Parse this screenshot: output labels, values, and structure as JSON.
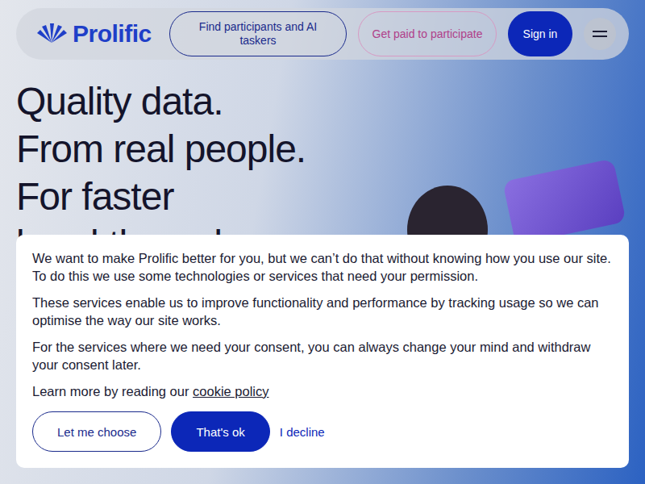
{
  "nav": {
    "logo": "Prolific",
    "buttons": [
      {
        "label": "Find participants and AI taskers",
        "kind": "outline"
      },
      {
        "label": "Get paid to participate",
        "kind": "pink"
      },
      {
        "label": "Sign in",
        "kind": "filled"
      }
    ]
  },
  "hero": {
    "lines": [
      "Quality data.",
      "From real people.",
      "For faster",
      "breakthroughs"
    ]
  },
  "cookie_banner": {
    "paragraphs": [
      "We want to make Prolific better for you, but we can’t do that without knowing how you use our site. To do this we use some technologies or services that need your permission.",
      "These services enable us to improve functionality and performance by tracking usage so we can optimise the way our site works.",
      "For the services where we need your consent, you can always change your mind and withdraw your consent later."
    ],
    "link_prefix": "Learn more by reading our ",
    "link": "cookie policy",
    "buttons": [
      {
        "label": "Let me choose",
        "kind": "outline"
      },
      {
        "label": "That's ok",
        "kind": "filled"
      },
      {
        "label": "I decline",
        "kind": "link"
      }
    ]
  }
}
